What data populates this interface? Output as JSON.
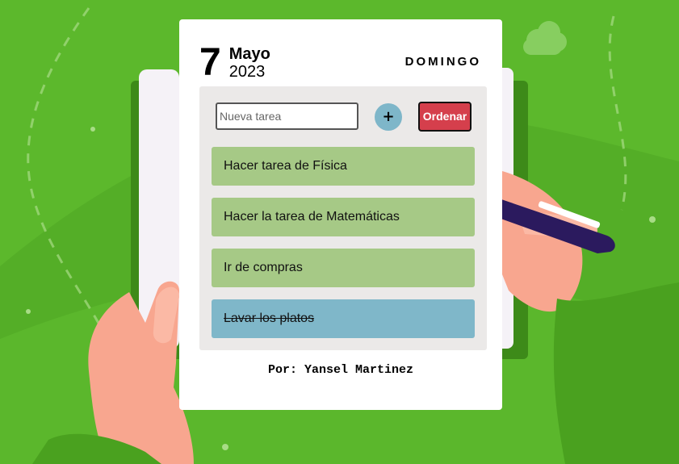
{
  "date": {
    "day": "7",
    "month": "Mayo",
    "year": "2023",
    "weekday": "DOMINGO"
  },
  "new_task": {
    "placeholder": "Nueva tarea",
    "value": ""
  },
  "add_button": {
    "label": "+"
  },
  "sort_button": {
    "label": "Ordenar"
  },
  "tasks": [
    {
      "text": "Hacer tarea de Física",
      "completed": false
    },
    {
      "text": "Hacer la tarea de Matemáticas",
      "completed": false
    },
    {
      "text": "Ir de compras",
      "completed": false
    },
    {
      "text": "Lavar los platos",
      "completed": true
    }
  ],
  "footer": {
    "author": "Por: Yansel Martinez"
  },
  "colors": {
    "background": "#5cb82c",
    "task_pending": "#a6c986",
    "task_done": "#7fb7c9",
    "sort_button": "#d53f4c",
    "add_button": "#7eb6c9"
  }
}
